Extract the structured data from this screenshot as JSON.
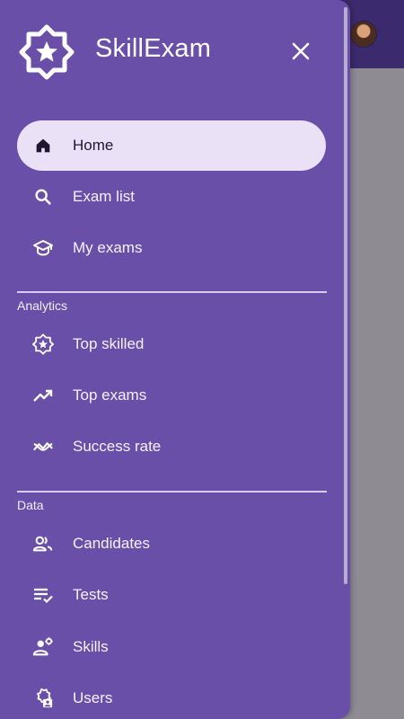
{
  "app": {
    "title": "SkillExam"
  },
  "colors": {
    "drawer_bg": "#6a4fa8",
    "appbar_bg": "#3c2a6e",
    "active_bg": "#ebe1f7",
    "text": "#ffffff"
  },
  "nav": {
    "main": [
      {
        "label": "Home",
        "icon": "home-icon",
        "active": true
      },
      {
        "label": "Exam list",
        "icon": "search-icon"
      },
      {
        "label": "My exams",
        "icon": "school-icon"
      }
    ],
    "analytics": {
      "section": "Analytics",
      "items": [
        {
          "label": "Top skilled",
          "icon": "star-badge-icon"
        },
        {
          "label": "Top exams",
          "icon": "trending-up-icon"
        },
        {
          "label": "Success rate",
          "icon": "ssid-chart-icon"
        }
      ]
    },
    "data": {
      "section": "Data",
      "items": [
        {
          "label": "Candidates",
          "icon": "people-icon"
        },
        {
          "label": "Tests",
          "icon": "playlist-check-icon"
        },
        {
          "label": "Skills",
          "icon": "person-gear-icon"
        },
        {
          "label": "Users",
          "icon": "admin-settings-icon"
        }
      ]
    }
  }
}
